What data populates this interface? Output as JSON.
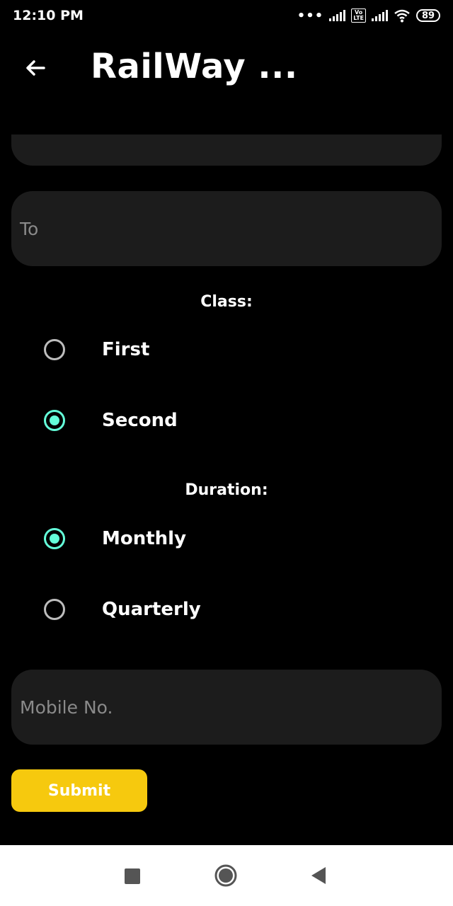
{
  "status_bar": {
    "time": "12:10 PM",
    "dots": "•••",
    "volte": "Vo\nLTE",
    "battery": "89",
    "icons": [
      "signal-icon",
      "volte-icon",
      "signal-icon",
      "wifi-icon",
      "battery-icon"
    ]
  },
  "toolbar": {
    "title": "RailWay ...",
    "back_icon": "arrow-left-icon"
  },
  "form": {
    "from_placeholder": "",
    "to_placeholder": "To",
    "class_label": "Class:",
    "class_options": [
      {
        "label": "First",
        "selected": false
      },
      {
        "label": "Second",
        "selected": true
      }
    ],
    "duration_label": "Duration:",
    "duration_options": [
      {
        "label": "Monthly",
        "selected": true
      },
      {
        "label": "Quarterly",
        "selected": false
      }
    ],
    "mobile_placeholder": "Mobile No.",
    "submit_label": "Submit"
  },
  "colors": {
    "accent": "#64ffda",
    "button": "#f6c90e",
    "field_bg": "#1c1c1c",
    "background": "#000000"
  },
  "nav": {
    "icons": [
      "recents-square-icon",
      "home-circle-icon",
      "back-triangle-icon"
    ]
  }
}
